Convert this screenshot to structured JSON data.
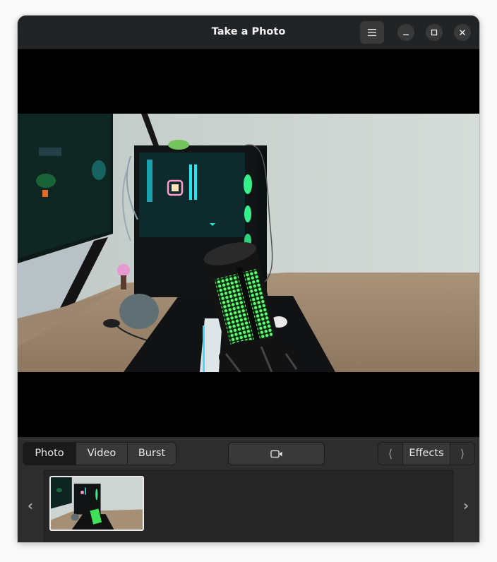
{
  "window": {
    "title": "Take a Photo",
    "menu_icon": "hamburger-menu-icon",
    "controls": {
      "minimize_icon": "minimize-icon",
      "maximize_icon": "maximize-icon",
      "close_icon": "close-icon"
    }
  },
  "mode_switcher": {
    "modes": [
      {
        "label": "Photo",
        "active": true
      },
      {
        "label": "Video",
        "active": false
      },
      {
        "label": "Burst",
        "active": false
      }
    ]
  },
  "shutter": {
    "icon": "video-camera-icon"
  },
  "effects": {
    "prev_glyph": "⟨",
    "label": "Effects",
    "next_glyph": "⟩"
  },
  "gallery": {
    "prev_glyph": "‹",
    "next_glyph": "›",
    "thumbnail_count": 1
  },
  "colors": {
    "headerbar": "#222324",
    "window_bg": "#2d2d2d",
    "button_bg": "#383838",
    "active_mode_bg": "#1a1a1a",
    "text": "#f2f2f2"
  }
}
